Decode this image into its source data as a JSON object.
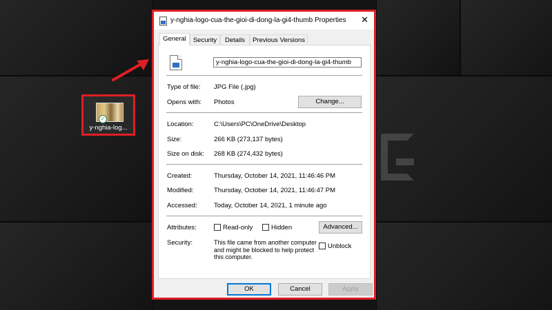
{
  "desktop": {
    "icon_label": "y-nghia-log...",
    "letter_watermark": "G"
  },
  "dialog": {
    "title": "y-nghia-logo-cua-the-gioi-di-dong-la-gi4-thumb Properties",
    "close_glyph": "✕",
    "tabs": [
      {
        "label": "General"
      },
      {
        "label": "Security"
      },
      {
        "label": "Details"
      },
      {
        "label": "Previous Versions"
      }
    ],
    "file_name": "y-nghia-logo-cua-the-gioi-di-dong-la-gi4-thumb",
    "rows": {
      "type_label": "Type of file:",
      "type_value": "JPG File (.jpg)",
      "opens_label": "Opens with:",
      "opens_value": "Photos",
      "change_button": "Change...",
      "location_label": "Location:",
      "location_value": "C:\\Users\\PC\\OneDrive\\Desktop",
      "size_label": "Size:",
      "size_value": "266 KB (273,137 bytes)",
      "sizedisk_label": "Size on disk:",
      "sizedisk_value": "268 KB (274,432 bytes)",
      "created_label": "Created:",
      "created_value": "Thursday, October 14, 2021, 11:46:46 PM",
      "modified_label": "Modified:",
      "modified_value": "Thursday, October 14, 2021, 11:46:47 PM",
      "accessed_label": "Accessed:",
      "accessed_value": "Today, October 14, 2021, 1 minute ago",
      "attributes_label": "Attributes:",
      "readonly_label": "Read-only",
      "hidden_label": "Hidden",
      "advanced_button": "Advanced...",
      "security_label": "Security:",
      "security_text": "This file came from another computer and might be blocked to help protect this computer.",
      "unblock_label": "Unblock"
    },
    "buttons": {
      "ok": "OK",
      "cancel": "Cancel",
      "apply": "Apply"
    }
  },
  "colors": {
    "highlight": "#e01e25",
    "focus": "#0078d7"
  }
}
